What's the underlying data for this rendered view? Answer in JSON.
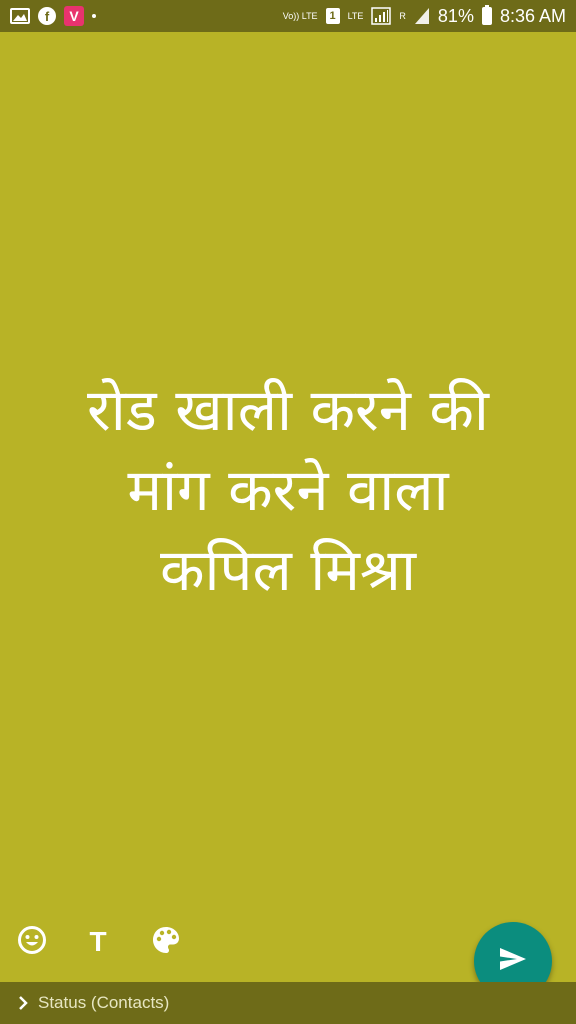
{
  "status_bar": {
    "left_icons": [
      "gallery-icon",
      "facebook-icon",
      "vidmate-icon",
      "dot-icon"
    ],
    "volte_label": "Vo)) LTE",
    "sim_label": "1",
    "lte_label": "LTE",
    "roaming_label": "R",
    "battery": "81%",
    "time": "8:36 AM"
  },
  "status": {
    "text": "रोड खाली करने की\nमांग करने वाला\nकपिल मिश्रा",
    "background_color": "#b8b326",
    "text_color": "#ffffff"
  },
  "toolbar": {
    "emoji_icon": "emoji-icon",
    "text_label": "T",
    "palette_icon": "palette-icon"
  },
  "send_button": {
    "icon": "send-icon",
    "color": "#0b8d7e"
  },
  "footer": {
    "recipients_label": "Status (Contacts)"
  }
}
